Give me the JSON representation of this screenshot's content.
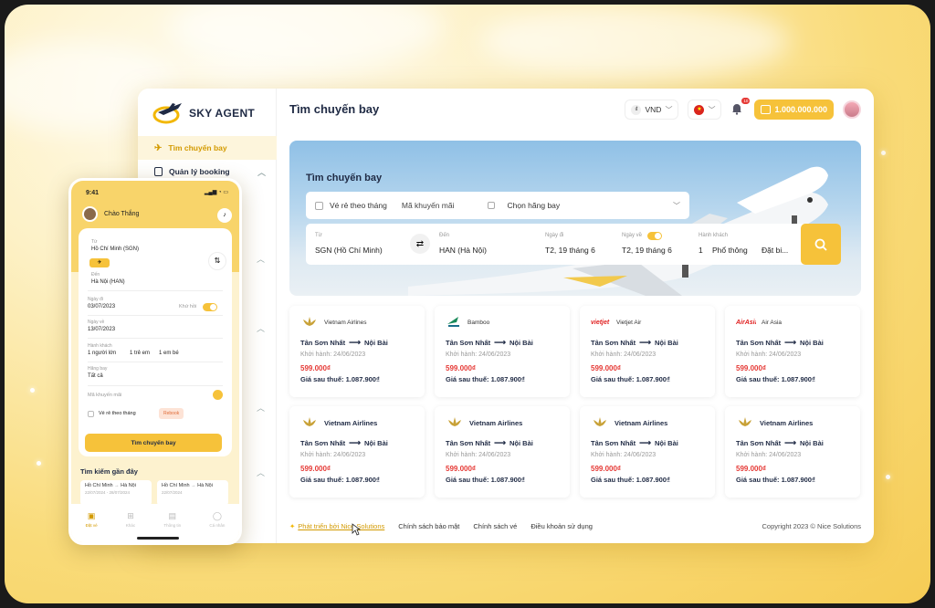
{
  "logo": {
    "text": "SKY AGENT"
  },
  "sidebar": {
    "items": [
      {
        "label": "Tìm chuyến bay"
      },
      {
        "label": "Quản lý booking"
      }
    ]
  },
  "header": {
    "title": "Tìm chuyến bay",
    "currency": "VND",
    "balance": "1.000.000.000",
    "notif_count": "10"
  },
  "search": {
    "title": "Tìm chuyến bay",
    "cheap_monthly": "Vé rẻ theo tháng",
    "promo": "Mã khuyến mãi",
    "airline_select": "Chọn hãng bay",
    "from_label": "Từ",
    "from": "SGN (Hồ Chí Minh)",
    "to_label": "Đến",
    "to": "HAN (Hà Nội)",
    "depart_label": "Ngày đi",
    "depart": "T2, 19 tháng 6",
    "return_label": "Ngày về",
    "return": "T2, 19 tháng 6",
    "pax_label": "Hành khách",
    "pax_count": "1",
    "cabin": "Phổ thông",
    "extra": "Đặt bi..."
  },
  "flights": [
    {
      "airline": "Vietnam Airlines",
      "from": "Tân Sơn Nhất",
      "to": "Nội Bài",
      "depart": "Khởi hành: 24/06/2023",
      "price": "599.000₫",
      "after_tax": "Giá sau thuế: 1.087.900₫",
      "logo": "lotus",
      "color": "#c8a137"
    },
    {
      "airline": "Bamboo",
      "from": "Tân Sơn Nhất",
      "to": "Nội Bài",
      "depart": "Khởi hành: 24/06/2023",
      "price": "599.000₫",
      "after_tax": "Giá sau thuế: 1.087.900₫",
      "logo": "bamboo",
      "color": "#1a8a5a"
    },
    {
      "airline": "Vietjet Air",
      "from": "Tân Sơn Nhất",
      "to": "Nội Bài",
      "depart": "Khởi hành: 24/06/2023",
      "price": "599.000₫",
      "after_tax": "Giá sau thuế: 1.087.900₫",
      "logo": "vietjet",
      "color": "#e02020"
    },
    {
      "airline": "Air Asia",
      "from": "Tân Sơn Nhất",
      "to": "Nội Bài",
      "depart": "Khởi hành: 24/06/2023",
      "price": "599.000₫",
      "after_tax": "Giá sau thuế: 1.087.900₫",
      "logo": "airasia",
      "color": "#e02020"
    },
    {
      "airline": "Vietnam Airlines",
      "from": "Tân Sơn Nhất",
      "to": "Nội Bài",
      "depart": "Khởi hành: 24/06/2023",
      "price": "599.000₫",
      "after_tax": "Giá sau thuế: 1.087.900₫",
      "logo": "lotus",
      "color": "#c8a137"
    },
    {
      "airline": "Vietnam Airlines",
      "from": "Tân Sơn Nhất",
      "to": "Nội Bài",
      "depart": "Khởi hành: 24/06/2023",
      "price": "599.000₫",
      "after_tax": "Giá sau thuế: 1.087.900₫",
      "logo": "lotus",
      "color": "#c8a137"
    },
    {
      "airline": "Vietnam Airlines",
      "from": "Tân Sơn Nhất",
      "to": "Nội Bài",
      "depart": "Khởi hành: 24/06/2023",
      "price": "599.000₫",
      "after_tax": "Giá sau thuế: 1.087.900₫",
      "logo": "lotus",
      "color": "#c8a137"
    },
    {
      "airline": "Vietnam Airlines",
      "from": "Tân Sơn Nhất",
      "to": "Nội Bài",
      "depart": "Khởi hành: 24/06/2023",
      "price": "599.000₫",
      "after_tax": "Giá sau thuế: 1.087.900₫",
      "logo": "lotus",
      "color": "#c8a137"
    }
  ],
  "footer": {
    "dev": "Phát triển bởi Nice Solutions",
    "privacy": "Chính sách bảo mật",
    "ticket": "Chính sách vé",
    "terms": "Điều khoản sử dụng",
    "copyright": "Copyright 2023 © Nice Solutions"
  },
  "mobile": {
    "time": "9:41",
    "greeting": "Chào Thắng",
    "from_label": "Từ",
    "from": "Hồ Chí Minh (SGN)",
    "to_label": "Đến",
    "to": "Hà Nội (HAN)",
    "depart_label": "Ngày đi",
    "depart": "03/07/2023",
    "roundtrip": "Khứ hồi",
    "return_label": "Ngày về",
    "return": "13/07/2023",
    "pax_label": "Hành khách",
    "adult": "1 người lớn",
    "child": "1 trẻ em",
    "infant": "1 em bé",
    "airline_label": "Hãng bay",
    "airline": "Tất cả",
    "promo_placeholder": "Mã khuyến mãi",
    "cheap_monthly": "Vé rẻ theo tháng",
    "rebook": "Rebook",
    "search_btn": "Tìm chuyến bay",
    "recent_title": "Tìm kiếm gần đây",
    "recent": [
      {
        "from": "Hồ Chí Minh",
        "to": "Hà Nội",
        "date": "22/07/2024 - 28/07/2024"
      },
      {
        "from": "Hồ Chí Minh",
        "to": "Hà Nội",
        "date": "22/07/2024"
      }
    ],
    "tabs": [
      {
        "label": "Đặt vé",
        "icon": "ticket-icon"
      },
      {
        "label": "Khác",
        "icon": "grid-icon"
      },
      {
        "label": "Thông tin",
        "icon": "doc-icon"
      },
      {
        "label": "Cá nhân",
        "icon": "user-icon"
      }
    ]
  },
  "colors": {
    "accent": "#f6c23a",
    "price": "#e53935",
    "navy": "#1f2a44"
  }
}
